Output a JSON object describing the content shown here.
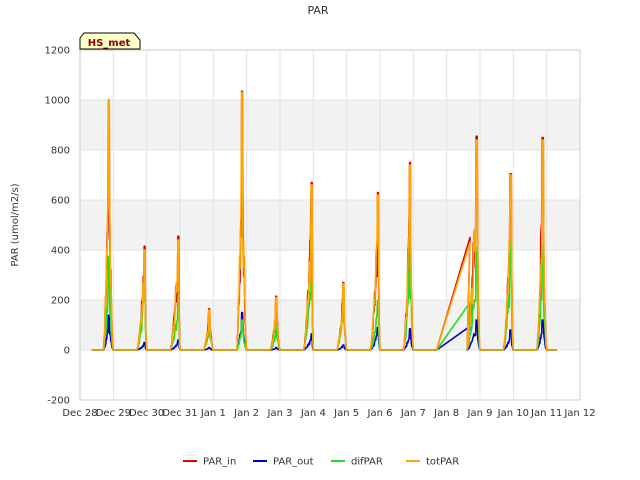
{
  "chart_data": {
    "type": "line",
    "title": "PAR",
    "ylabel": "PAR (umol/m2/s)",
    "xlabel": "",
    "badge": "HS_met",
    "ylim": [
      -200,
      1200
    ],
    "yticks": [
      -200,
      0,
      200,
      400,
      600,
      800,
      1000,
      1200
    ],
    "xlim": [
      0,
      15
    ],
    "xticks": [
      {
        "v": 0,
        "label": "Dec 28"
      },
      {
        "v": 1,
        "label": "Dec 29"
      },
      {
        "v": 2,
        "label": "Dec 30"
      },
      {
        "v": 3,
        "label": "Dec 31"
      },
      {
        "v": 4,
        "label": "Jan 1"
      },
      {
        "v": 5,
        "label": "Jan 2"
      },
      {
        "v": 6,
        "label": "Jan 3"
      },
      {
        "v": 7,
        "label": "Jan 4"
      },
      {
        "v": 8,
        "label": "Jan 5"
      },
      {
        "v": 9,
        "label": "Jan 6"
      },
      {
        "v": 10,
        "label": "Jan 7"
      },
      {
        "v": 11,
        "label": "Jan 8"
      },
      {
        "v": 12,
        "label": "Jan 9"
      },
      {
        "v": 13,
        "label": "Jan 10"
      },
      {
        "v": 14,
        "label": "Jan 11"
      },
      {
        "v": 15,
        "label": "Jan 12"
      }
    ],
    "grid": true,
    "legend_position": "bottom",
    "colors": {
      "PAR_in": "#e00000",
      "PAR_out": "#0000d0",
      "difPAR": "#22dd22",
      "totPAR": "#ffa500",
      "band": "#f2f2f2",
      "grid": "#e3e3e3",
      "badge_bg": "#ffffc8"
    },
    "series": [
      {
        "name": "PAR_in",
        "peaks": [
          1000,
          415,
          455,
          165,
          1035,
          215,
          670,
          270,
          630,
          750,
          855,
          705,
          850
        ],
        "values_source": "daily_peaks"
      },
      {
        "name": "PAR_out",
        "peaks": [
          140,
          30,
          40,
          10,
          150,
          10,
          65,
          20,
          90,
          85,
          120,
          80,
          120
        ]
      },
      {
        "name": "difPAR",
        "peaks": [
          375,
          290,
          220,
          120,
          120,
          100,
          420,
          230,
          200,
          460,
          410,
          430,
          420
        ]
      },
      {
        "name": "totPAR",
        "peaks": [
          1000,
          400,
          440,
          160,
          1030,
          210,
          660,
          265,
          620,
          740,
          840,
          700,
          840
        ]
      }
    ]
  }
}
